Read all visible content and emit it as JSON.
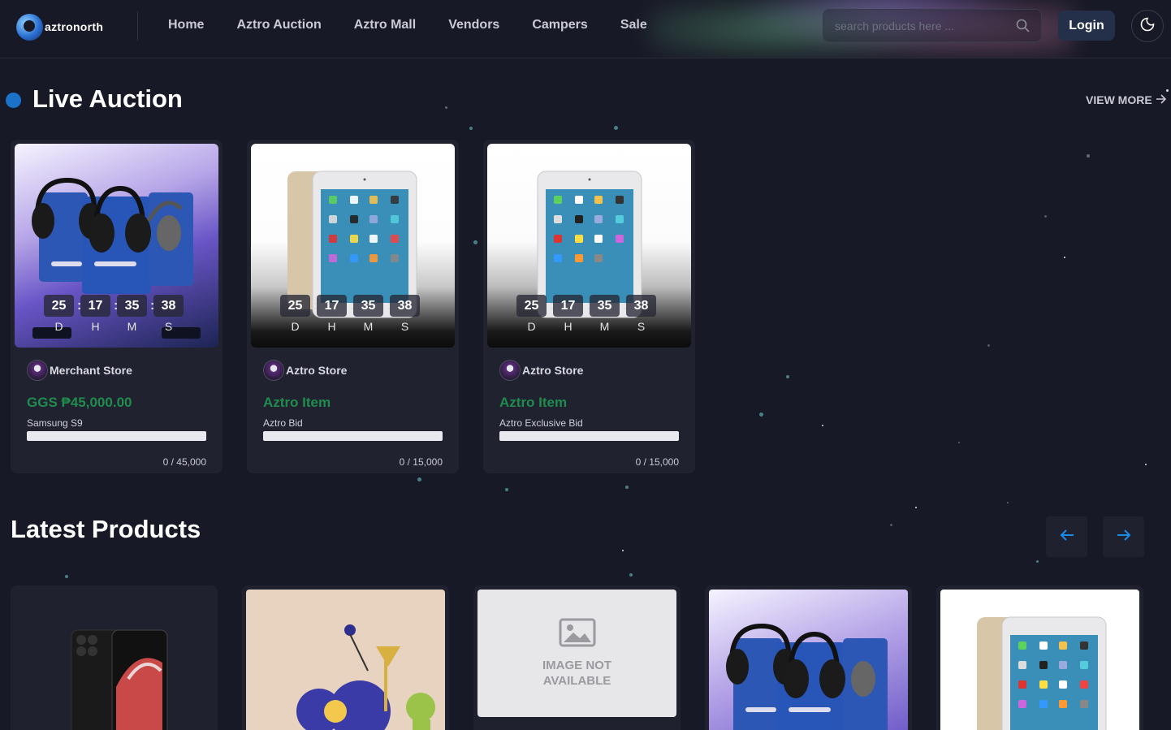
{
  "header": {
    "logo_text": "aztronorth",
    "nav": [
      "Home",
      "Aztro Auction",
      "Aztro Mall",
      "Vendors",
      "Campers",
      "Sale"
    ],
    "search_placeholder": "search products here ...",
    "login_label": "Login",
    "icons": {
      "search": "search-icon",
      "theme": "moon-icon"
    }
  },
  "live_auction": {
    "title": "Live Auction",
    "view_more": "VIEW MORE",
    "countdown_labels": [
      "D",
      "H",
      "M",
      "S"
    ],
    "cards": [
      {
        "countdown": [
          "25",
          "17",
          "35",
          "38"
        ],
        "store": "Merchant Store",
        "price": "GGS ₱45,000.00",
        "item": "Samsung S9",
        "progress": 0,
        "bids": "0 / 45,000"
      },
      {
        "countdown": [
          "25",
          "17",
          "35",
          "38"
        ],
        "store": "Aztro Store",
        "price": "Aztro Item",
        "item": "Aztro Bid",
        "progress": 0,
        "bids": "0 / 15,000"
      },
      {
        "countdown": [
          "25",
          "17",
          "35",
          "38"
        ],
        "store": "Aztro Store",
        "price": "Aztro Item",
        "item": "Aztro Exclusive Bid",
        "progress": 0,
        "bids": "0 / 15,000"
      }
    ]
  },
  "latest_products": {
    "title": "Latest Products",
    "image_not_available": "IMAGE NOT AVAILABLE",
    "icons": {
      "prev": "arrow-left-icon",
      "next": "arrow-right-icon"
    }
  },
  "colors": {
    "background": "#181926",
    "card": "#21222f",
    "accent_green": "#1f8c4e",
    "accent_blue": "#1a73c9",
    "login_bg": "#24304a"
  }
}
